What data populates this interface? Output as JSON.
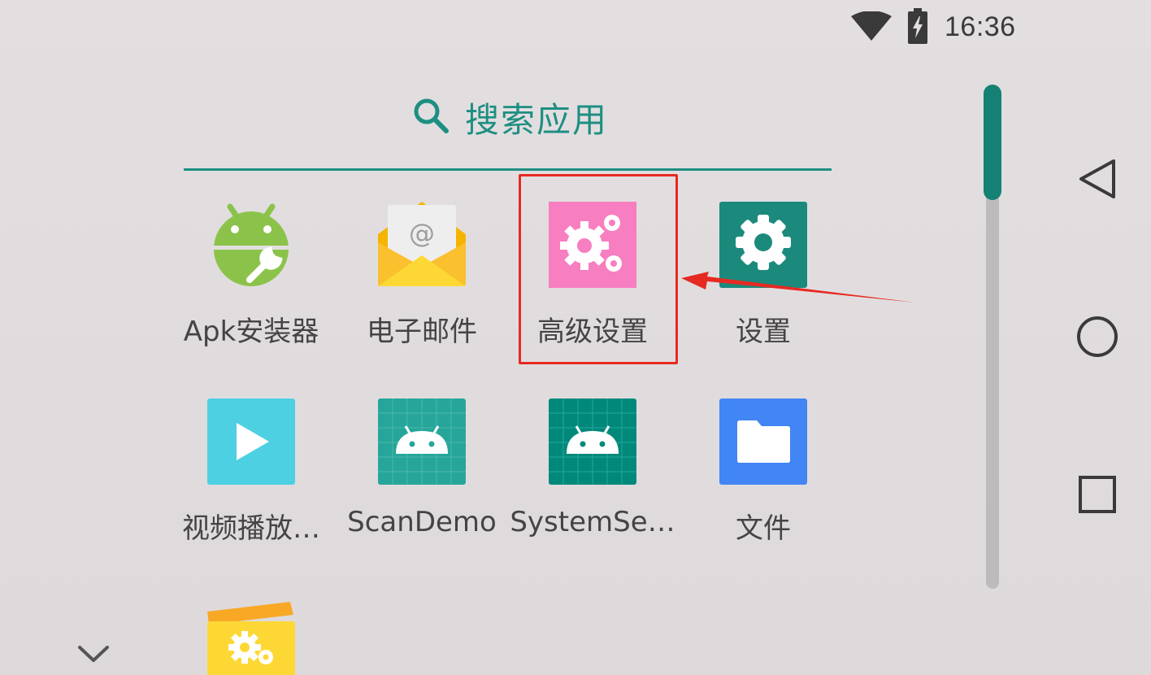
{
  "status_bar": {
    "time": "16:36",
    "wifi_icon": "wifi-icon",
    "battery_icon": "battery-charging-icon"
  },
  "search": {
    "label": "搜索应用",
    "icon": "search-icon",
    "accent": "#1e8f82"
  },
  "apps": [
    {
      "label": "Apk安装器",
      "icon": "apk-installer-icon"
    },
    {
      "label": "电子邮件",
      "icon": "email-icon"
    },
    {
      "label": "高级设置",
      "icon": "advanced-settings-icon",
      "highlighted": true
    },
    {
      "label": "设置",
      "icon": "settings-icon"
    },
    {
      "label": "视频播放…",
      "icon": "video-player-icon"
    },
    {
      "label": "ScanDemo",
      "icon": "scandemo-icon"
    },
    {
      "label": "SystemSe…",
      "icon": "systemse-icon"
    },
    {
      "label": "文件",
      "icon": "files-icon"
    },
    {
      "label": "",
      "icon": "settings-card-icon"
    }
  ],
  "nav": {
    "back": "back-icon",
    "home": "home-icon",
    "recents": "recents-icon"
  },
  "annotation": {
    "color": "#e62a22"
  },
  "scrollbar": {
    "thumb_color": "#148174"
  }
}
